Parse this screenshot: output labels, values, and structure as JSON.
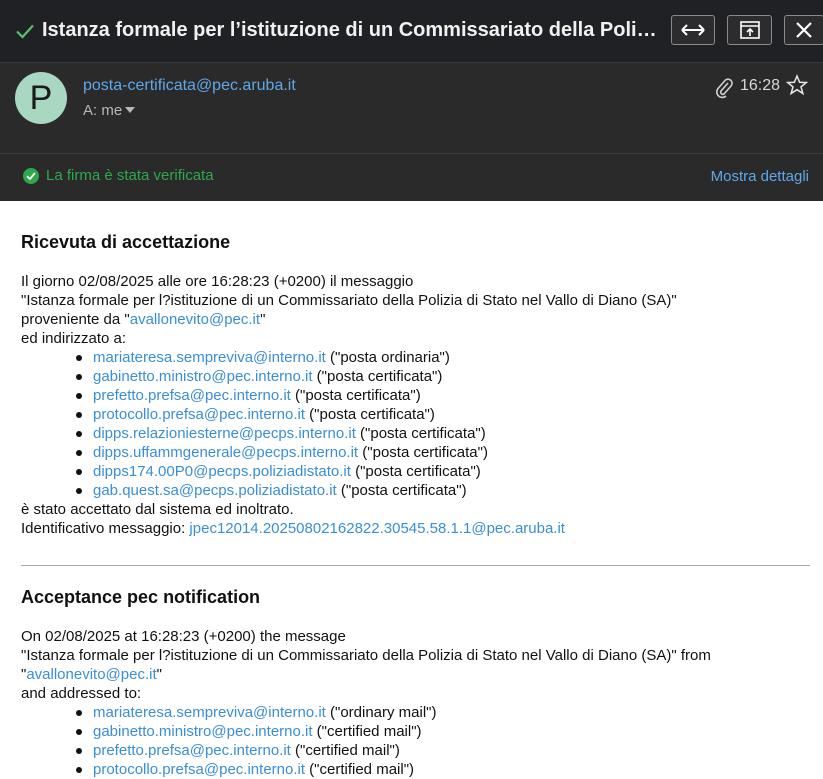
{
  "window": {
    "title": "Istanza formale per l’istituzione di un Commissariato della Poli…"
  },
  "header": {
    "avatar_letter": "P",
    "sender": "posta-certificata@pec.aruba.it",
    "to_label": "A: me",
    "time": "16:28",
    "signature_status": "La firma è stata verificata",
    "show_details": "Mostra dettagli"
  },
  "italian": {
    "heading": "Ricevuta di accettazione",
    "line1": "Il giorno 02/08/2025 alle ore 16:28:23 (+0200) il messaggio",
    "line2": "\"Istanza formale per l?istituzione di un Commissariato della Polizia di Stato nel Vallo di Diano (SA)\"",
    "line3_prefix": "proveniente da \"",
    "line3_link": "avallonevito@pec.it",
    "line3_suffix": "\"",
    "line4": "ed indirizzato a:",
    "recipients": [
      {
        "email": "mariateresa.sempreviva@interno.it",
        "type": " (\"posta ordinaria\")"
      },
      {
        "email": "gabinetto.ministro@pec.interno.it",
        "type": " (\"posta certificata\")"
      },
      {
        "email": "prefetto.prefsa@pec.interno.it",
        "type": " (\"posta certificata\")"
      },
      {
        "email": "protocollo.prefsa@pec.interno.it",
        "type": " (\"posta certificata\")"
      },
      {
        "email": "dipps.relazioniesterne@pecps.interno.it",
        "type": " (\"posta certificata\")"
      },
      {
        "email": "dipps.uffammgenerale@pecps.interno.it",
        "type": " (\"posta certificata\")"
      },
      {
        "email": "dipps174.00P0@pecps.poliziadistato.it",
        "type": " (\"posta certificata\")"
      },
      {
        "email": "gab.quest.sa@pecps.poliziadistato.it",
        "type": " (\"posta certificata\")"
      }
    ],
    "accepted": "è stato accettato dal sistema ed inoltrato.",
    "id_label": "Identificativo messaggio: ",
    "id_value": "jpec12014.20250802162822.30545.58.1.1@pec.aruba.it"
  },
  "english": {
    "heading": "Acceptance pec notification",
    "line1": "On 02/08/2025 at 16:28:23 (+0200) the message",
    "line2": "\"Istanza formale per l?istituzione di un Commissariato della Polizia di Stato nel Vallo di Diano (SA)\" from",
    "line3_prefix": "\"",
    "line3_link": "avallonevito@pec.it",
    "line3_suffix": "\"",
    "line4": "and addressed to:",
    "recipients": [
      {
        "email": "mariateresa.sempreviva@interno.it",
        "type": " (\"ordinary mail\")"
      },
      {
        "email": "gabinetto.ministro@pec.interno.it",
        "type": " (\"certified mail\")"
      },
      {
        "email": "prefetto.prefsa@pec.interno.it",
        "type": " (\"certified mail\")"
      },
      {
        "email": "protocollo.prefsa@pec.interno.it",
        "type": " (\"certified mail\")"
      }
    ]
  },
  "colors": {
    "titlebar_bg": "#202124",
    "header_bg": "#2a2a2b",
    "link": "#3a8ed8",
    "verified_green": "#2ea84a"
  },
  "icons": [
    "check-icon",
    "expand-icon",
    "popout-icon",
    "close-icon",
    "paperclip-icon",
    "star-icon",
    "verified-icon",
    "caret-down-icon"
  ]
}
